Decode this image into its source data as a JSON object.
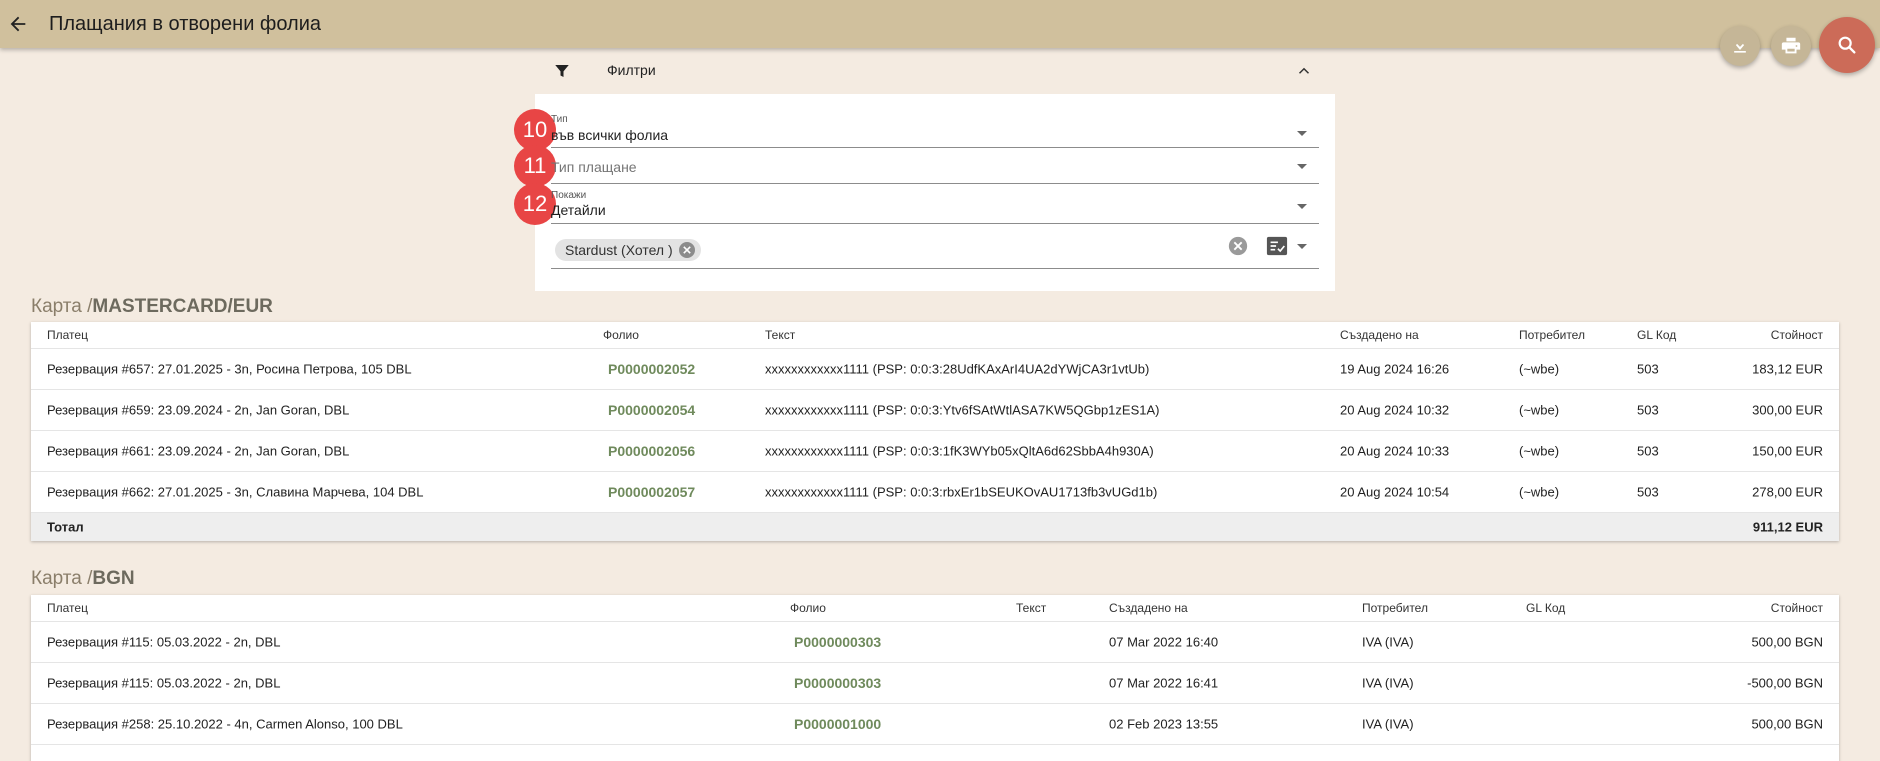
{
  "header": {
    "title": "Плащания в отворени фолиа"
  },
  "filters": {
    "label": "Филтри",
    "fields": [
      {
        "badge": "10",
        "label": "Тип",
        "value": "във всички фолиа"
      },
      {
        "badge": "11",
        "placeholder": "Тип плащане"
      },
      {
        "badge": "12",
        "label": "Покажи",
        "value": "Детайли"
      }
    ],
    "chip": "Stardust (Хотел )"
  },
  "sections": [
    {
      "title_prefix": "Карта /",
      "title_main": "MASTERCARD/EUR",
      "columns": [
        "Платец",
        "Фолио",
        "Текст",
        "Създадено на",
        "Потребител",
        "GL Код",
        "Стойност"
      ],
      "rows": [
        [
          "Резервация #657: 27.01.2025 - 3n, Росина Петрова, 105 DBL",
          "P0000002052",
          "xxxxxxxxxxxx1111 (PSP: 0:0:3:28UdfKAxArI4UA2dYWjCA3r1vtUb)",
          "19 Aug 2024 16:26",
          "(~wbe)",
          "503",
          "183,12 EUR"
        ],
        [
          "Резервация #659: 23.09.2024 - 2n, Jan Goran, DBL",
          "P0000002054",
          "xxxxxxxxxxxx1111 (PSP: 0:0:3:Ytv6fSAtWtlASA7KW5QGbp1zES1A)",
          "20 Aug 2024 10:32",
          "(~wbe)",
          "503",
          "300,00 EUR"
        ],
        [
          "Резервация #661: 23.09.2024 - 2n, Jan Goran, DBL",
          "P0000002056",
          "xxxxxxxxxxxx1111 (PSP: 0:0:3:1fK3WYb05xQltA6d62SbbA4h930A)",
          "20 Aug 2024 10:33",
          "(~wbe)",
          "503",
          "150,00 EUR"
        ],
        [
          "Резервация #662: 27.01.2025 - 3n, Славина Марчева, 104 DBL",
          "P0000002057",
          "xxxxxxxxxxxx1111 (PSP: 0:0:3:rbxEr1bSEUKOvAU1713fb3vUGd1b)",
          "20 Aug 2024 10:54",
          "(~wbe)",
          "503",
          "278,00 EUR"
        ]
      ],
      "total_label": "Тотал",
      "total_value": "911,12 EUR"
    },
    {
      "title_prefix": "Карта /",
      "title_main": "BGN",
      "columns": [
        "Платец",
        "Фолио",
        "Текст",
        "Създадено на",
        "Потребител",
        "GL Код",
        "Стойност"
      ],
      "rows": [
        [
          "Резервация #115: 05.03.2022 - 2n, DBL",
          "P0000000303",
          "",
          "07 Mar 2022 16:40",
          "IVA (IVA)",
          "",
          "500,00 BGN"
        ],
        [
          "Резервация #115: 05.03.2022 - 2n, DBL",
          "P0000000303",
          "",
          "07 Mar 2022 16:41",
          "IVA (IVA)",
          "",
          "-500,00 BGN"
        ],
        [
          "Резервация #258: 25.10.2022 - 4n, Carmen Alonso, 100 DBL",
          "P0000001000",
          "",
          "02 Feb 2023 13:55",
          "IVA (IVA)",
          "",
          "500,00 BGN"
        ]
      ]
    }
  ]
}
